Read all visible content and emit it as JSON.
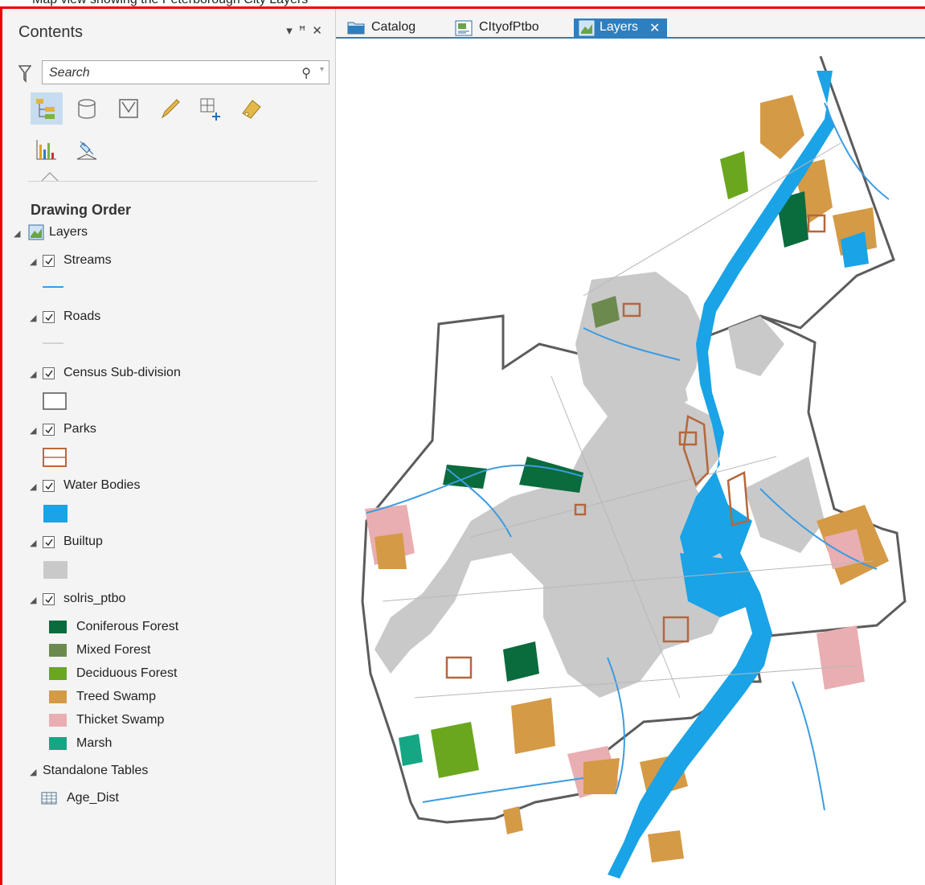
{
  "window": {
    "top_text": "Map view showing the Peterborough City Layers"
  },
  "contents_pane": {
    "title": "Contents",
    "search_placeholder": "Search",
    "section_title": "Drawing Order",
    "layers_root": "Layers",
    "layers": [
      {
        "name": "Streams",
        "checked": true
      },
      {
        "name": "Roads",
        "checked": true
      },
      {
        "name": "Census Sub-division",
        "checked": true
      },
      {
        "name": "Parks",
        "checked": true
      },
      {
        "name": "Water Bodies",
        "checked": true
      },
      {
        "name": "Builtup",
        "checked": true
      },
      {
        "name": "solris_ptbo",
        "checked": true
      }
    ],
    "solris_legend": [
      {
        "label": "Coniferous Forest",
        "color": "#0a6b3d"
      },
      {
        "label": "Mixed Forest",
        "color": "#6c8a4e"
      },
      {
        "label": "Deciduous Forest",
        "color": "#6aa71e"
      },
      {
        "label": "Treed Swamp",
        "color": "#d49a46"
      },
      {
        "label": "Thicket Swamp",
        "color": "#e9aeb1"
      },
      {
        "label": "Marsh",
        "color": "#15a784"
      }
    ],
    "standalone_title": "Standalone Tables",
    "tables": [
      {
        "name": "Age_Dist"
      }
    ]
  },
  "tabs": [
    {
      "label": "Catalog",
      "active": false
    },
    {
      "label": "CItyofPtbo",
      "active": false
    },
    {
      "label": "Layers",
      "active": true
    }
  ],
  "colors": {
    "accent": "#2e7fbf",
    "water": "#1aa3e6",
    "builtup": "#c9c9c9",
    "parks": "#b5673c",
    "boundary": "#555555",
    "stream": "#3d9be0"
  }
}
